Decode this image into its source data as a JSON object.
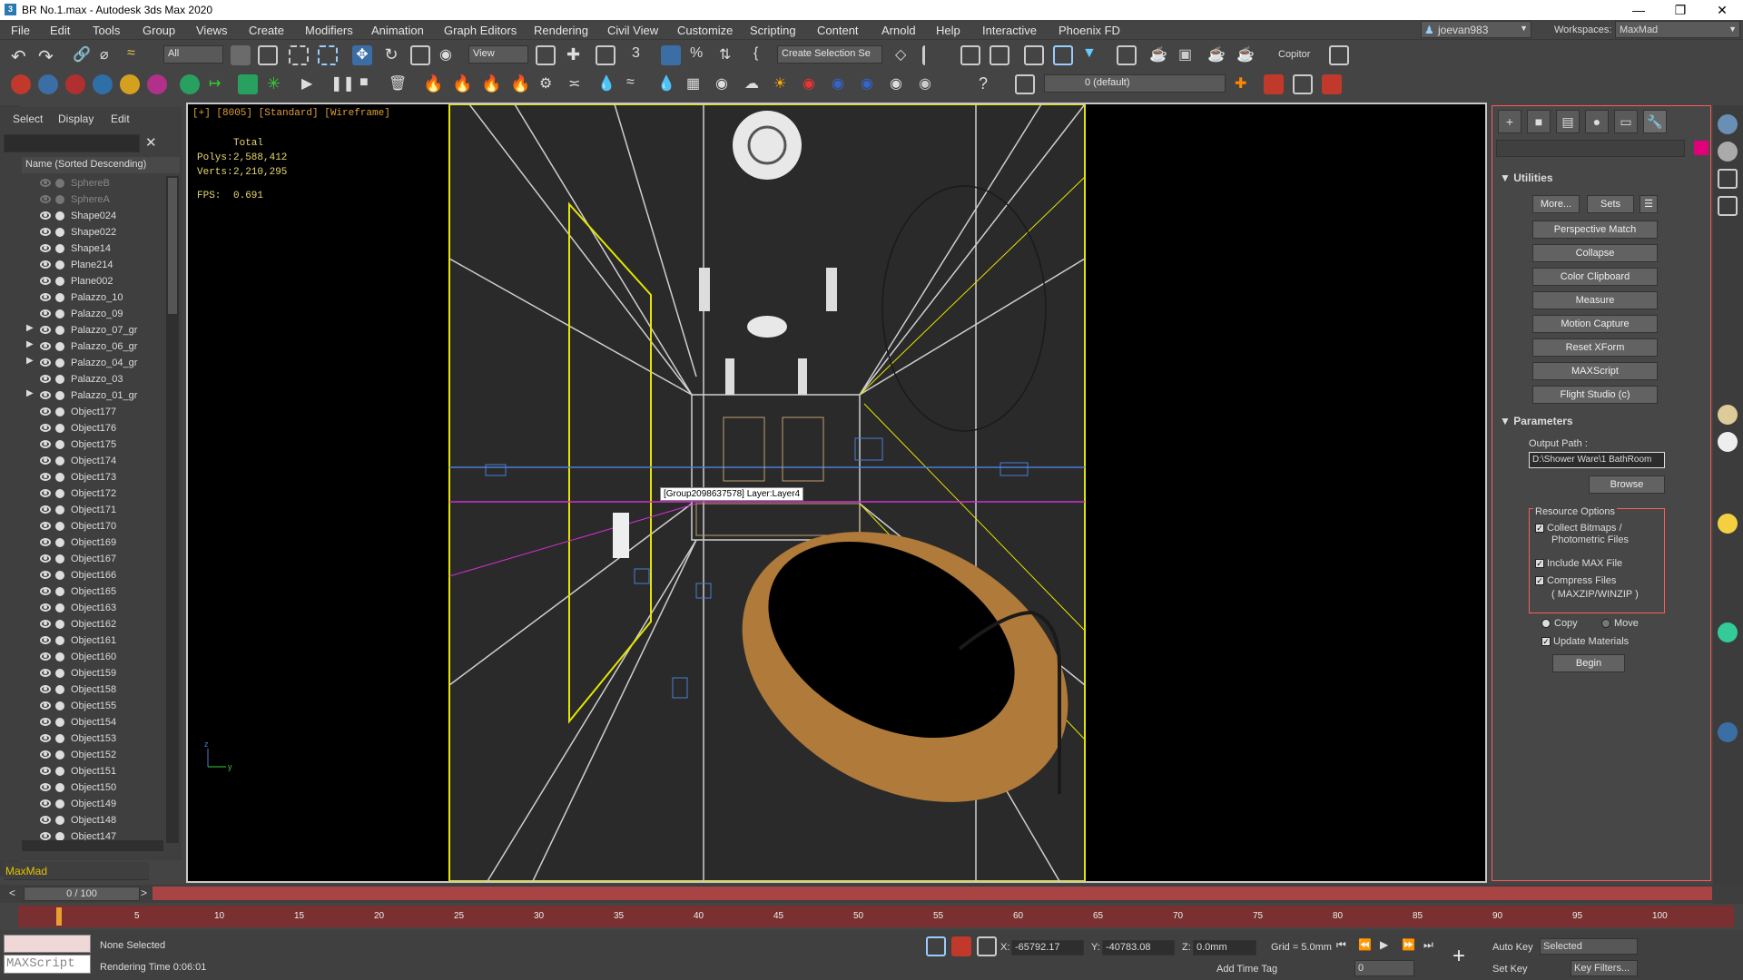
{
  "window": {
    "title": "BR No.1.max - Autodesk 3ds Max 2020",
    "controls": [
      "—",
      "❐",
      "✕"
    ]
  },
  "menu": {
    "items": [
      "File",
      "Edit",
      "Tools",
      "Group",
      "Views",
      "Create",
      "Modifiers",
      "Animation",
      "Graph Editors",
      "Rendering",
      "Civil View",
      "Customize",
      "Scripting",
      "Content",
      "Arnold",
      "Help",
      "Interactive",
      "Phoenix FD"
    ],
    "user": "joevan983",
    "workspaces_label": "Workspaces:",
    "workspace": "MaxMad"
  },
  "toolbar": {
    "filter": "All",
    "refcoord": "View",
    "selection_set": "Create Selection Se",
    "copitor": "Copitor",
    "layer": "0 (default)"
  },
  "scene_explorer": {
    "tabs": [
      "Select",
      "Display",
      "Edit"
    ],
    "header": "Name (Sorted Descending)",
    "rows": [
      {
        "name": "SphereB",
        "dim": true,
        "group": false
      },
      {
        "name": "SphereA",
        "dim": true,
        "group": false
      },
      {
        "name": "Shape024",
        "dim": false,
        "group": false
      },
      {
        "name": "Shape022",
        "dim": false,
        "group": false
      },
      {
        "name": "Shape14",
        "dim": false,
        "group": false
      },
      {
        "name": "Plane214",
        "dim": false,
        "group": false
      },
      {
        "name": "Plane002",
        "dim": false,
        "group": false
      },
      {
        "name": "Palazzo_10",
        "dim": false,
        "group": false
      },
      {
        "name": "Palazzo_09",
        "dim": false,
        "group": false
      },
      {
        "name": "Palazzo_07_gr",
        "dim": false,
        "group": true
      },
      {
        "name": "Palazzo_06_gr",
        "dim": false,
        "group": true
      },
      {
        "name": "Palazzo_04_gr",
        "dim": false,
        "group": true
      },
      {
        "name": "Palazzo_03",
        "dim": false,
        "group": false
      },
      {
        "name": "Palazzo_01_gr",
        "dim": false,
        "group": true
      },
      {
        "name": "Object177",
        "dim": false,
        "group": false
      },
      {
        "name": "Object176",
        "dim": false,
        "group": false
      },
      {
        "name": "Object175",
        "dim": false,
        "group": false
      },
      {
        "name": "Object174",
        "dim": false,
        "group": false
      },
      {
        "name": "Object173",
        "dim": false,
        "group": false
      },
      {
        "name": "Object172",
        "dim": false,
        "group": false
      },
      {
        "name": "Object171",
        "dim": false,
        "group": false
      },
      {
        "name": "Object170",
        "dim": false,
        "group": false
      },
      {
        "name": "Object169",
        "dim": false,
        "group": false
      },
      {
        "name": "Object167",
        "dim": false,
        "group": false
      },
      {
        "name": "Object166",
        "dim": false,
        "group": false
      },
      {
        "name": "Object165",
        "dim": false,
        "group": false
      },
      {
        "name": "Object163",
        "dim": false,
        "group": false
      },
      {
        "name": "Object162",
        "dim": false,
        "group": false
      },
      {
        "name": "Object161",
        "dim": false,
        "group": false
      },
      {
        "name": "Object160",
        "dim": false,
        "group": false
      },
      {
        "name": "Object159",
        "dim": false,
        "group": false
      },
      {
        "name": "Object158",
        "dim": false,
        "group": false
      },
      {
        "name": "Object155",
        "dim": false,
        "group": false
      },
      {
        "name": "Object154",
        "dim": false,
        "group": false
      },
      {
        "name": "Object153",
        "dim": false,
        "group": false
      },
      {
        "name": "Object152",
        "dim": false,
        "group": false
      },
      {
        "name": "Object151",
        "dim": false,
        "group": false
      },
      {
        "name": "Object150",
        "dim": false,
        "group": false
      },
      {
        "name": "Object149",
        "dim": false,
        "group": false
      },
      {
        "name": "Object148",
        "dim": false,
        "group": false
      },
      {
        "name": "Object147",
        "dim": false,
        "group": false
      }
    ],
    "layer_explorer": "MaxMad"
  },
  "viewport": {
    "label": "[+] [8005] [Standard] [Wireframe]",
    "stats": {
      "total_label": "Total",
      "polys_label": "Polys:",
      "polys": "2,588,412",
      "verts_label": "Verts:",
      "verts": "2,210,295",
      "fps_label": "FPS:",
      "fps": "0.691"
    },
    "tooltip": "[Group2098637578] Layer:Layer4"
  },
  "command_panel": {
    "utilities_title": "Utilities",
    "more": "More...",
    "sets": "Sets",
    "buttons": [
      "Perspective Match",
      "Collapse",
      "Color Clipboard",
      "Measure",
      "Motion Capture",
      "Reset XForm",
      "MAXScript",
      "Flight Studio (c)"
    ],
    "parameters_title": "Parameters",
    "output_path_label": "Output Path :",
    "output_path": "D:\\Shower Ware\\1 BathRoom",
    "browse": "Browse",
    "resource_options": "Resource Options",
    "collect_bitmaps": "Collect Bitmaps /",
    "collect_bitmaps2": "Photometric Files",
    "include_max": "Include MAX File",
    "compress": "Compress Files",
    "compress2": "( MAXZIP/WINZIP )",
    "copy": "Copy",
    "move": "Move",
    "update_materials": "Update Materials",
    "begin": "Begin"
  },
  "timeline": {
    "frame": "0 / 100",
    "ticks": [
      "5",
      "10",
      "15",
      "20",
      "25",
      "30",
      "35",
      "40",
      "45",
      "50",
      "55",
      "60",
      "65",
      "70",
      "75",
      "80",
      "85",
      "90",
      "95",
      "100"
    ]
  },
  "status": {
    "selection": "None Selected",
    "render_time": "Rendering Time  0:06:01",
    "maxscript": "MAXScript",
    "x_label": "X:",
    "x": "-65792.17",
    "y_label": "Y:",
    "y": "-40783.08",
    "z_label": "Z:",
    "z": "0.0mm",
    "grid": "Grid = 5.0mm",
    "add_time_tag": "Add Time Tag",
    "auto_key": "Auto Key",
    "selected": "Selected",
    "set_key": "Set Key",
    "key_filters": "Key Filters...",
    "frame_field": "0"
  }
}
